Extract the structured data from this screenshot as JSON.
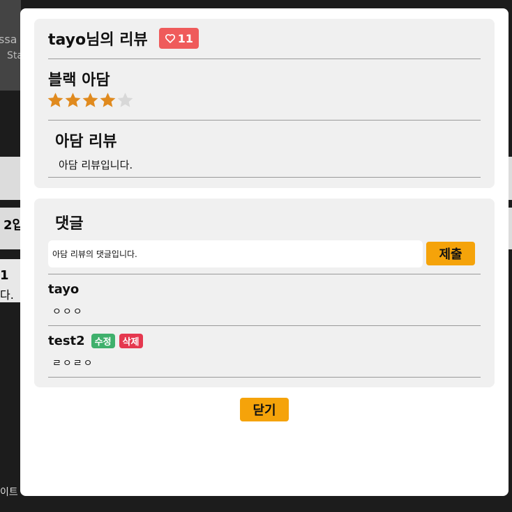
{
  "background": {
    "fragments": [
      "ssa",
      "Sta",
      "2입",
      "1",
      "다.",
      "이트"
    ]
  },
  "review": {
    "title": "tayo님의 리뷰",
    "likes": "11",
    "movie_title": "블랙 아담",
    "rating": 4,
    "rating_max": 5,
    "star_color": "#e08a1e",
    "review_title": "아담 리뷰",
    "review_body": "아담 리뷰입니다."
  },
  "comments": {
    "title": "댓글",
    "input_value": "아담 리뷰의 댓글입니다.",
    "submit_label": "제출",
    "items": [
      {
        "author": "tayo",
        "body": "ㅇㅇㅇ"
      },
      {
        "author": "test2",
        "body": "ㄹㅇㄹㅇ",
        "edit_label": "수정",
        "delete_label": "삭제"
      }
    ]
  },
  "close_label": "닫기"
}
